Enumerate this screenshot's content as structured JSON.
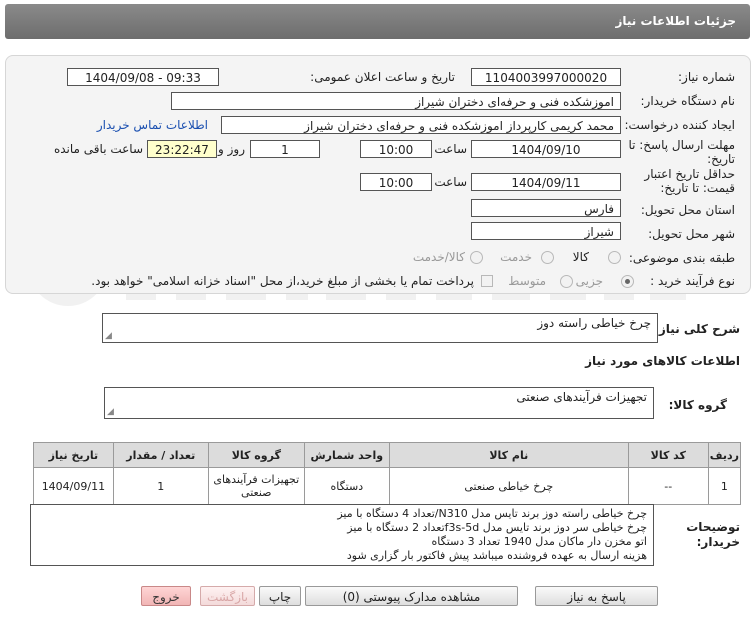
{
  "header": {
    "title": "جزئیات اطلاعات نیاز"
  },
  "fields": {
    "need_number_label": "شماره نیاز:",
    "need_number": "1104003997000020",
    "announce_label": "تاریخ و ساعت اعلان عمومی:",
    "announce_value": "1404/09/08 - 09:33",
    "buyer_org_label": "نام دستگاه خریدار:",
    "buyer_org": "اموزشکده فنی و حرفه‌ای دختران شیراز",
    "creator_label": "ایجاد کننده درخواست:",
    "creator": "محمد کریمی کارپرداز اموزشکده فنی و حرفه‌ای دختران شیراز",
    "contact_link": "اطلاعات تماس خریدار",
    "reply_deadline_label_1": "مهلت ارسال پاسخ: تا",
    "reply_deadline_label_2": "تاریخ:",
    "reply_date": "1404/09/10",
    "time_label": "ساعت",
    "reply_time": "10:00",
    "days_value": "1",
    "days_label": "روز و",
    "remaining_time": "23:22:47",
    "remaining_label": "ساعت باقی مانده",
    "validity_label_1": "حداقل تاریخ اعتبار",
    "validity_label_2": "قیمت: تا تاریخ:",
    "validity_date": "1404/09/11",
    "validity_time": "10:00",
    "province_label": "استان محل تحویل:",
    "province": "فارس",
    "city_label": "شهر محل تحویل:",
    "city": "شیراز",
    "category_label": "طبقه بندی موضوعی:",
    "category_options": [
      "کالا",
      "خدمت",
      "کالا/خدمت"
    ],
    "process_label": "نوع فرآیند خرید :",
    "process_options": [
      "جزیی",
      "متوسط"
    ],
    "payment_note": "پرداخت تمام یا بخشی از مبلغ خرید،از محل \"اسناد خزانه اسلامی\" خواهد بود."
  },
  "summary": {
    "label": "شرح کلی نیاز:",
    "value": "چرخ خیاطی راسته دوز"
  },
  "goods_info": {
    "title": "اطلاعات کالاهای مورد نیاز",
    "group_label": "گروه کالا:",
    "group_value": "تجهیزات فرآیندهای صنعتی"
  },
  "table": {
    "headers": [
      "ردیف",
      "کد کالا",
      "نام کالا",
      "واحد شمارش",
      "گروه کالا",
      "تعداد / مقدار",
      "تاریخ نیاز"
    ],
    "rows": [
      [
        "1",
        "--",
        "چرخ خیاطی صنعتی",
        "دستگاه",
        "تجهیزات فرآیندهای صنعتی",
        "1",
        "1404/09/11"
      ]
    ]
  },
  "buyer_notes": {
    "label_1": "توضیحات",
    "label_2": "خریدار:",
    "lines": [
      "چرخ خیاطی راسته دوز برند تایس مدل N310/تعداد 4 دستگاه با میز",
      "چرخ خیاطی سر دوز برند تایس مدل f3s-5dتعداد 2 دستگاه با میز",
      "اتو مخزن دار ماکان مدل 1940 تعداد 3 دستگاه",
      "هزینه ارسال به عهده فروشنده میباشد پیش فاکتور بار گزاری شود"
    ]
  },
  "buttons": {
    "reply": "پاسخ به نیاز",
    "attachments": "مشاهده مدارک پیوستی (0)",
    "print": "چاپ",
    "back": "بازگشت",
    "exit": "خروج"
  },
  "colors": {
    "header_bg": "#777777",
    "link": "#1a4fb0",
    "remaining_bg": "#ffffcc"
  }
}
